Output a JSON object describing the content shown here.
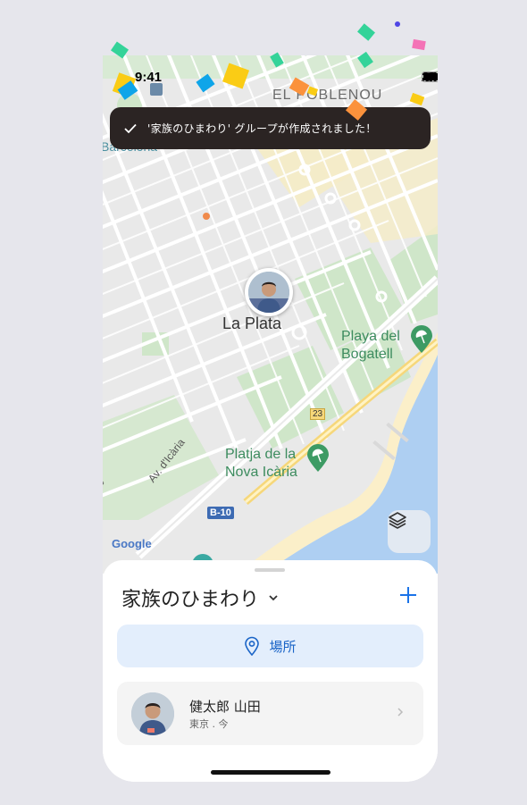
{
  "status_bar": {
    "time": "9:41"
  },
  "toast": {
    "message": "'家族のひまわり' グループが作成されました！"
  },
  "map": {
    "labels": {
      "neighborhood": "EL POBLENOU",
      "city_fragment": "Barcelona",
      "district": "La Plata",
      "beach1_line1": "Playa del",
      "beach1_line2": "Bogatell",
      "beach2_line1": "Platja de la",
      "beach2_line2": "Nova Icària",
      "street": "Av. d'Icària",
      "street_fragment": "ina",
      "road_badge": "B-10",
      "exit_badge": "23",
      "attribution": "Google"
    },
    "colors": {
      "land": "#e9e9e9",
      "park": "#cfe6c9",
      "water": "#aecff2",
      "beach": "#fbefc9",
      "road": "#ffffff"
    }
  },
  "sheet": {
    "group_name": "家族のひまわり",
    "places_label": "場所",
    "members": [
      {
        "name": "健太郎 山田",
        "status": "東京 . 今"
      }
    ]
  },
  "icons": [
    "check-icon",
    "signal-icon",
    "wifi-icon",
    "battery-icon",
    "layers-icon",
    "chevron-down-icon",
    "plus-icon",
    "location-pin-icon",
    "chevron-right-icon",
    "metro-icon",
    "beach-umbrella-icon"
  ],
  "colors": {
    "accent": "#1a73e8",
    "toast_bg": "#2b2423",
    "places_bg": "#e3eefc"
  }
}
